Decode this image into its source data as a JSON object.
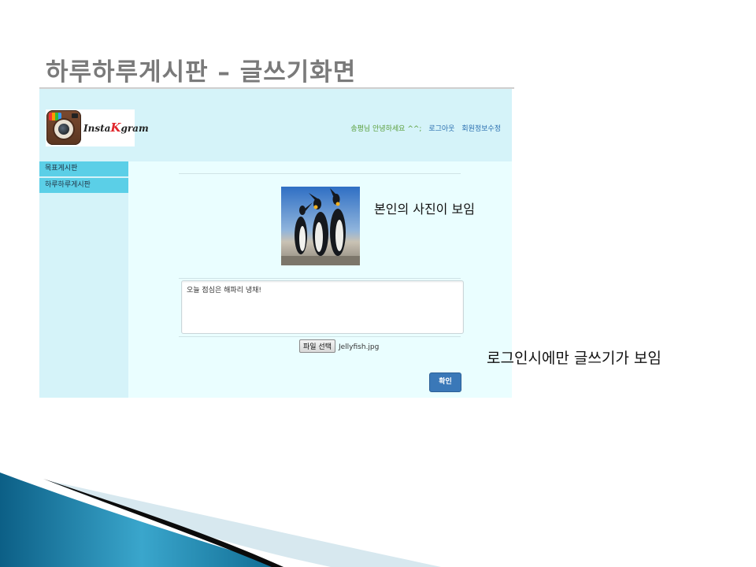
{
  "slide": {
    "title": "하루하루게시판 – 글쓰기화면"
  },
  "app": {
    "logo_text_pre": "Insta",
    "logo_text_k": "K",
    "logo_text_post": "gram",
    "greeting": "송평님 안녕하세요 ^^;",
    "logout": "로그아웃",
    "edit_profile": "회원정보수정"
  },
  "sidebar": {
    "items": [
      {
        "label": "목표게시판"
      },
      {
        "label": "하루하루게시판"
      }
    ]
  },
  "post": {
    "text": "오늘 점심은 해파리 냉채!",
    "file_button": "파일 선택",
    "file_name": "Jellyfish.jpg",
    "confirm": "확인"
  },
  "annotations": {
    "photo_caption": "본인의 사진이 보임",
    "login_caption": "로그인시에만 글쓰기가 보임"
  },
  "colors": {
    "header_bg": "#d5f3f9",
    "content_bg": "#eafeff",
    "sidebar_item": "#5bcfe7",
    "button": "#3a78b8"
  }
}
